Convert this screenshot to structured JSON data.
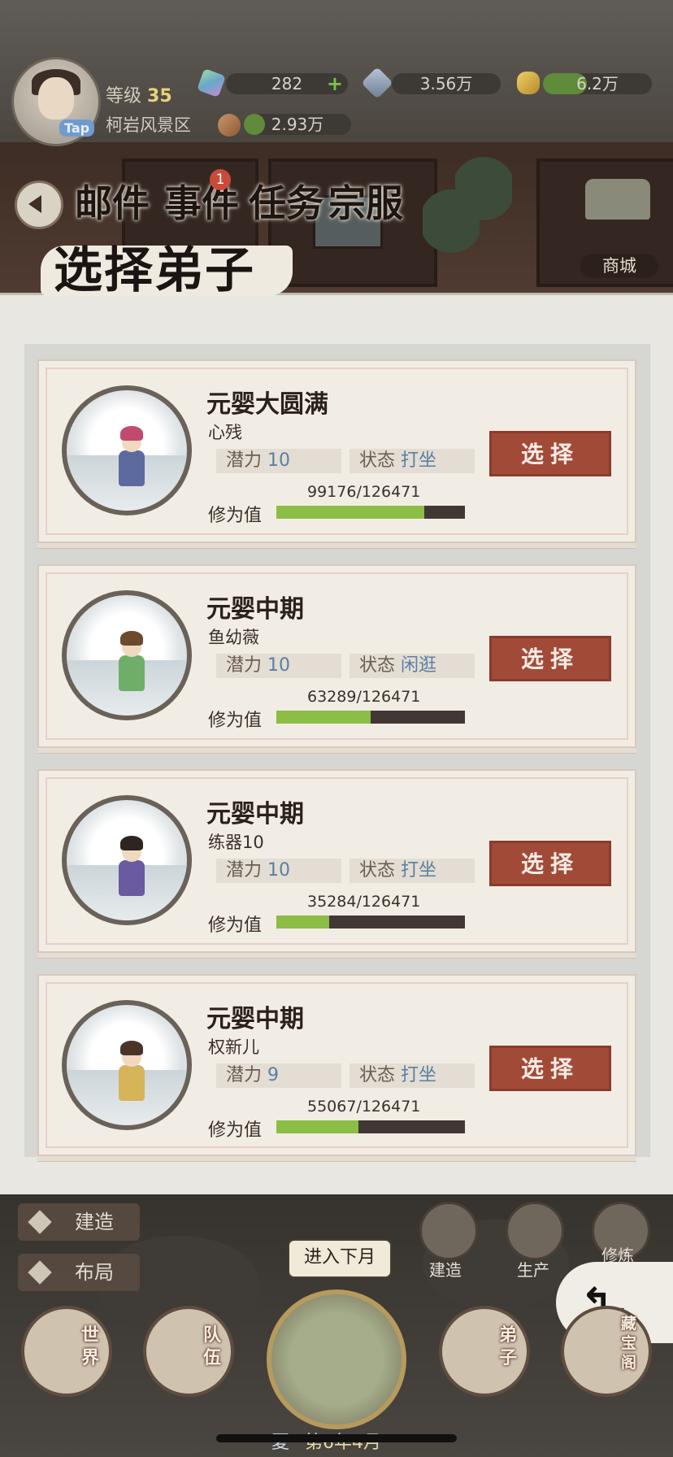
{
  "header": {
    "avatar_tag": "Tap",
    "level_label": "等级",
    "level_value": "35",
    "region": "柯岩风景区",
    "resources": [
      {
        "icon": "jade-icon",
        "value": "282",
        "plus": "+",
        "fill": 0.0
      },
      {
        "icon": "crystal-icon",
        "value": "3.56万",
        "fill": 0.0
      },
      {
        "icon": "gold-icon",
        "value": "6.2万",
        "fill": 0.4
      },
      {
        "icon": "food-icon",
        "value": "2.93万",
        "fill": 0.2
      }
    ]
  },
  "nav": {
    "mail": "邮件",
    "events": "事件",
    "events_badge": "1",
    "tasks": "任务",
    "sect_clothing": "宗服",
    "shop": "商城"
  },
  "dialog": {
    "title": "选择弟子",
    "potential_label": "潜力",
    "state_label": "状态",
    "cultivation_label": "修为值",
    "select_label": "选择"
  },
  "disciples": [
    {
      "rank": "元婴大圆满",
      "name": "心残",
      "potential": "10",
      "state": "打坐",
      "progress_text": "99176/126471",
      "progress": 0.784
    },
    {
      "rank": "元婴中期",
      "name": "鱼幼薇",
      "potential": "10",
      "state": "闲逛",
      "progress_text": "63289/126471",
      "progress": 0.5
    },
    {
      "rank": "元婴中期",
      "name": "练器10",
      "potential": "10",
      "state": "打坐",
      "progress_text": "35284/126471",
      "progress": 0.279
    },
    {
      "rank": "元婴中期",
      "name": "权新儿",
      "potential": "9",
      "state": "打坐",
      "progress_text": "55067/126471",
      "progress": 0.435
    }
  ],
  "bottom": {
    "build_side": "建造",
    "layout_side": "布局",
    "next_month": "进入下月",
    "build_round": "建造",
    "produce": "生产",
    "cultivate": "修炼",
    "world": "世界",
    "team": "队伍",
    "disciples": "弟子",
    "treasury": "藏宝阁",
    "season": "夏",
    "date": "第6年4月"
  },
  "colors": {
    "select_button": "#a24a38",
    "progress_fill": "#8bbd47",
    "progress_track": "#413836",
    "potential_value": "#5b7fa3"
  }
}
